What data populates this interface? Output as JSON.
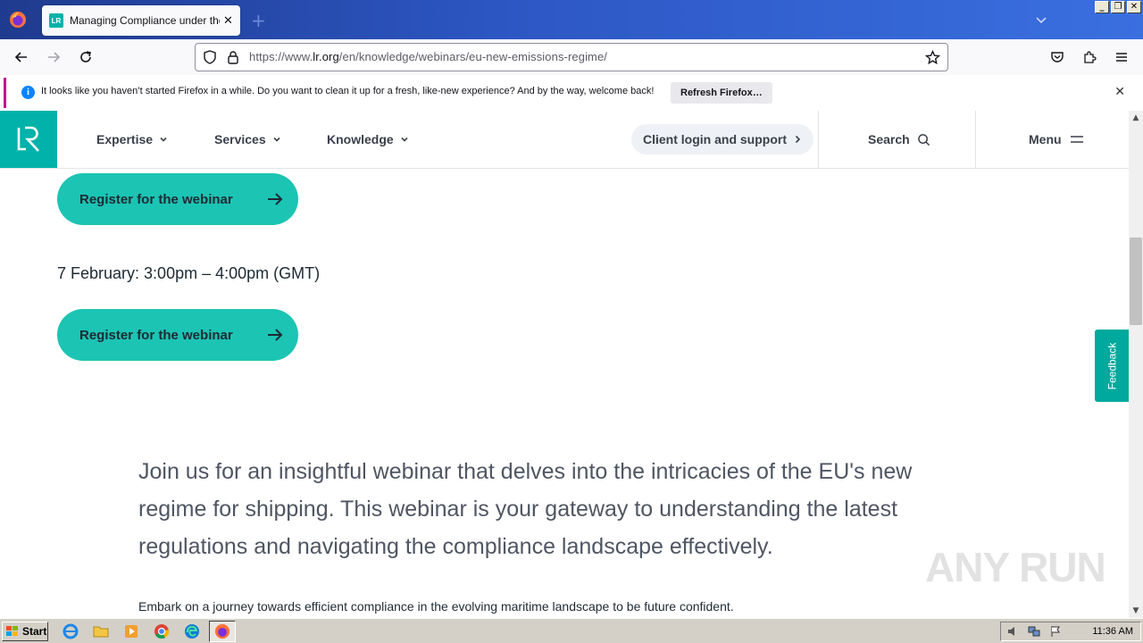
{
  "browser": {
    "tab_title": "Managing Compliance under the EU",
    "tab_favicon_text": "LR",
    "url_prefix": "https://www.",
    "url_host": "lr.org",
    "url_path": "/en/knowledge/webinars/eu-new-emissions-regime/",
    "notification_text": "It looks like you haven’t started Firefox in a while. Do you want to clean it up for a fresh, like-new experience? And by the way, welcome back!",
    "notification_button": "Refresh Firefox…"
  },
  "site": {
    "nav": [
      "Expertise",
      "Services",
      "Knowledge"
    ],
    "client_login": "Client login and support",
    "search_label": "Search",
    "menu_label": "Menu",
    "feedback_label": "Feedback"
  },
  "content": {
    "register_label_1": "Register for the webinar",
    "register_label_2": "Register for the webinar",
    "session_date": "7 February: 3:00pm – 4:00pm (GMT)",
    "lead_paragraph": "Join us for an insightful webinar that delves into the intricacies of the EU's new regime for shipping. This webinar is your gateway to understanding the latest regulations and navigating the compliance landscape effectively.",
    "body_paragraph": "Embark on a journey towards efficient compliance in the evolving maritime landscape to be future confident."
  },
  "watermark": "ANY RUN",
  "taskbar": {
    "start_label": "Start",
    "clock": "11:36 AM"
  },
  "colors": {
    "brand_teal": "#00b2a9",
    "button_teal": "#1cc4b4",
    "text_dark": "#1d2a33"
  }
}
